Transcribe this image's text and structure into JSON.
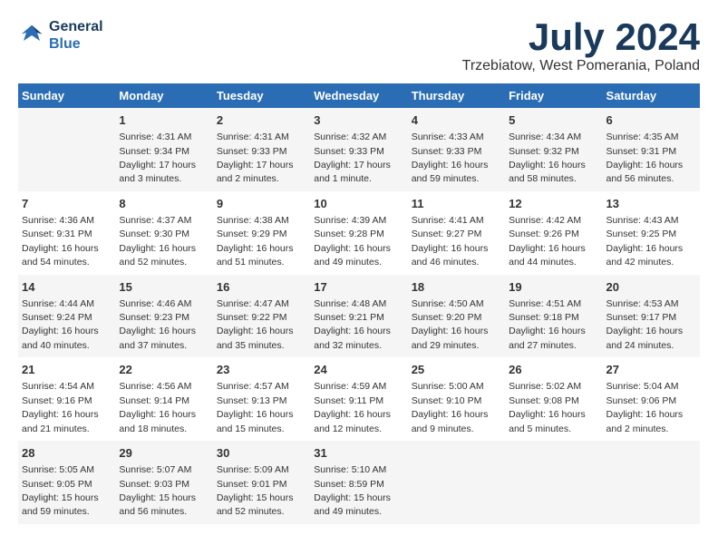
{
  "header": {
    "logo_line1": "General",
    "logo_line2": "Blue",
    "month": "July 2024",
    "location": "Trzebiatow, West Pomerania, Poland"
  },
  "weekdays": [
    "Sunday",
    "Monday",
    "Tuesday",
    "Wednesday",
    "Thursday",
    "Friday",
    "Saturday"
  ],
  "weeks": [
    [
      {
        "day": "",
        "sunrise": "",
        "sunset": "",
        "daylight": ""
      },
      {
        "day": "1",
        "sunrise": "Sunrise: 4:31 AM",
        "sunset": "Sunset: 9:34 PM",
        "daylight": "Daylight: 17 hours and 3 minutes."
      },
      {
        "day": "2",
        "sunrise": "Sunrise: 4:31 AM",
        "sunset": "Sunset: 9:33 PM",
        "daylight": "Daylight: 17 hours and 2 minutes."
      },
      {
        "day": "3",
        "sunrise": "Sunrise: 4:32 AM",
        "sunset": "Sunset: 9:33 PM",
        "daylight": "Daylight: 17 hours and 1 minute."
      },
      {
        "day": "4",
        "sunrise": "Sunrise: 4:33 AM",
        "sunset": "Sunset: 9:33 PM",
        "daylight": "Daylight: 16 hours and 59 minutes."
      },
      {
        "day": "5",
        "sunrise": "Sunrise: 4:34 AM",
        "sunset": "Sunset: 9:32 PM",
        "daylight": "Daylight: 16 hours and 58 minutes."
      },
      {
        "day": "6",
        "sunrise": "Sunrise: 4:35 AM",
        "sunset": "Sunset: 9:31 PM",
        "daylight": "Daylight: 16 hours and 56 minutes."
      }
    ],
    [
      {
        "day": "7",
        "sunrise": "Sunrise: 4:36 AM",
        "sunset": "Sunset: 9:31 PM",
        "daylight": "Daylight: 16 hours and 54 minutes."
      },
      {
        "day": "8",
        "sunrise": "Sunrise: 4:37 AM",
        "sunset": "Sunset: 9:30 PM",
        "daylight": "Daylight: 16 hours and 52 minutes."
      },
      {
        "day": "9",
        "sunrise": "Sunrise: 4:38 AM",
        "sunset": "Sunset: 9:29 PM",
        "daylight": "Daylight: 16 hours and 51 minutes."
      },
      {
        "day": "10",
        "sunrise": "Sunrise: 4:39 AM",
        "sunset": "Sunset: 9:28 PM",
        "daylight": "Daylight: 16 hours and 49 minutes."
      },
      {
        "day": "11",
        "sunrise": "Sunrise: 4:41 AM",
        "sunset": "Sunset: 9:27 PM",
        "daylight": "Daylight: 16 hours and 46 minutes."
      },
      {
        "day": "12",
        "sunrise": "Sunrise: 4:42 AM",
        "sunset": "Sunset: 9:26 PM",
        "daylight": "Daylight: 16 hours and 44 minutes."
      },
      {
        "day": "13",
        "sunrise": "Sunrise: 4:43 AM",
        "sunset": "Sunset: 9:25 PM",
        "daylight": "Daylight: 16 hours and 42 minutes."
      }
    ],
    [
      {
        "day": "14",
        "sunrise": "Sunrise: 4:44 AM",
        "sunset": "Sunset: 9:24 PM",
        "daylight": "Daylight: 16 hours and 40 minutes."
      },
      {
        "day": "15",
        "sunrise": "Sunrise: 4:46 AM",
        "sunset": "Sunset: 9:23 PM",
        "daylight": "Daylight: 16 hours and 37 minutes."
      },
      {
        "day": "16",
        "sunrise": "Sunrise: 4:47 AM",
        "sunset": "Sunset: 9:22 PM",
        "daylight": "Daylight: 16 hours and 35 minutes."
      },
      {
        "day": "17",
        "sunrise": "Sunrise: 4:48 AM",
        "sunset": "Sunset: 9:21 PM",
        "daylight": "Daylight: 16 hours and 32 minutes."
      },
      {
        "day": "18",
        "sunrise": "Sunrise: 4:50 AM",
        "sunset": "Sunset: 9:20 PM",
        "daylight": "Daylight: 16 hours and 29 minutes."
      },
      {
        "day": "19",
        "sunrise": "Sunrise: 4:51 AM",
        "sunset": "Sunset: 9:18 PM",
        "daylight": "Daylight: 16 hours and 27 minutes."
      },
      {
        "day": "20",
        "sunrise": "Sunrise: 4:53 AM",
        "sunset": "Sunset: 9:17 PM",
        "daylight": "Daylight: 16 hours and 24 minutes."
      }
    ],
    [
      {
        "day": "21",
        "sunrise": "Sunrise: 4:54 AM",
        "sunset": "Sunset: 9:16 PM",
        "daylight": "Daylight: 16 hours and 21 minutes."
      },
      {
        "day": "22",
        "sunrise": "Sunrise: 4:56 AM",
        "sunset": "Sunset: 9:14 PM",
        "daylight": "Daylight: 16 hours and 18 minutes."
      },
      {
        "day": "23",
        "sunrise": "Sunrise: 4:57 AM",
        "sunset": "Sunset: 9:13 PM",
        "daylight": "Daylight: 16 hours and 15 minutes."
      },
      {
        "day": "24",
        "sunrise": "Sunrise: 4:59 AM",
        "sunset": "Sunset: 9:11 PM",
        "daylight": "Daylight: 16 hours and 12 minutes."
      },
      {
        "day": "25",
        "sunrise": "Sunrise: 5:00 AM",
        "sunset": "Sunset: 9:10 PM",
        "daylight": "Daylight: 16 hours and 9 minutes."
      },
      {
        "day": "26",
        "sunrise": "Sunrise: 5:02 AM",
        "sunset": "Sunset: 9:08 PM",
        "daylight": "Daylight: 16 hours and 5 minutes."
      },
      {
        "day": "27",
        "sunrise": "Sunrise: 5:04 AM",
        "sunset": "Sunset: 9:06 PM",
        "daylight": "Daylight: 16 hours and 2 minutes."
      }
    ],
    [
      {
        "day": "28",
        "sunrise": "Sunrise: 5:05 AM",
        "sunset": "Sunset: 9:05 PM",
        "daylight": "Daylight: 15 hours and 59 minutes."
      },
      {
        "day": "29",
        "sunrise": "Sunrise: 5:07 AM",
        "sunset": "Sunset: 9:03 PM",
        "daylight": "Daylight: 15 hours and 56 minutes."
      },
      {
        "day": "30",
        "sunrise": "Sunrise: 5:09 AM",
        "sunset": "Sunset: 9:01 PM",
        "daylight": "Daylight: 15 hours and 52 minutes."
      },
      {
        "day": "31",
        "sunrise": "Sunrise: 5:10 AM",
        "sunset": "Sunset: 8:59 PM",
        "daylight": "Daylight: 15 hours and 49 minutes."
      },
      {
        "day": "",
        "sunrise": "",
        "sunset": "",
        "daylight": ""
      },
      {
        "day": "",
        "sunrise": "",
        "sunset": "",
        "daylight": ""
      },
      {
        "day": "",
        "sunrise": "",
        "sunset": "",
        "daylight": ""
      }
    ]
  ]
}
